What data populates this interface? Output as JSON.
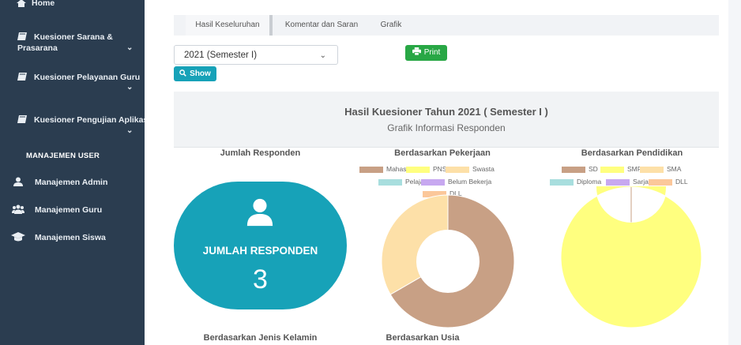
{
  "sidebar": {
    "home": "Home",
    "sarana_line1": "Kuesioner Sarana &",
    "sarana_line2": "Prasarana",
    "pelayanan": "Kuesioner Pelayanan Guru",
    "pengujian": "Kuesioner Pengujian Aplikasi",
    "section_header": "MANAJEMEN USER",
    "admin": "Manajemen Admin",
    "guru": "Manajemen Guru",
    "siswa": "Manajemen Siswa"
  },
  "tabs": [
    "Hasil Keseluruhan",
    "Komentar dan Saran",
    "Grafik"
  ],
  "filter": {
    "selected": "2021 (Semester I)",
    "print_label": "Print",
    "show_label": "Show"
  },
  "panel": {
    "title": "Hasil Kuesioner Tahun 2021 ( Semester I )",
    "subtitle": "Grafik Informasi Responden"
  },
  "card": {
    "label": "JUMLAH RESPONDEN",
    "value": "3"
  },
  "sections": {
    "jumlah": "Jumlah Responden",
    "pekerjaan": "Berdasarkan Pekerjaan",
    "pendidikan": "Berdasarkan Pendidikan",
    "jenis_kelamin": "Berdasarkan Jenis Kelamin",
    "usia": "Berdasarkan Usia"
  },
  "chart_data": [
    {
      "type": "pie",
      "title": "Berdasarkan Pekerjaan",
      "categories": [
        "Mahasiswa",
        "PNS",
        "Swasta",
        "Pelajar",
        "Belum Bekerja",
        "DLL"
      ],
      "values": [
        2,
        0,
        1,
        0,
        0,
        0
      ],
      "colors": [
        "#c8a085",
        "#ffff7f",
        "#fde0a8",
        "#a8dede",
        "#c7a8f0",
        "#fbc79a"
      ],
      "legend": "top"
    },
    {
      "type": "pie",
      "title": "Berdasarkan Pendidikan",
      "categories": [
        "SD",
        "SMP",
        "SMA",
        "Diploma",
        "Sarjana",
        "DLL"
      ],
      "values": [
        0,
        3,
        0,
        0,
        0,
        0
      ],
      "colors": [
        "#c8a085",
        "#ffff7f",
        "#fde0a8",
        "#a8dede",
        "#c7a8f0",
        "#fbc79a"
      ],
      "legend": "top"
    }
  ]
}
